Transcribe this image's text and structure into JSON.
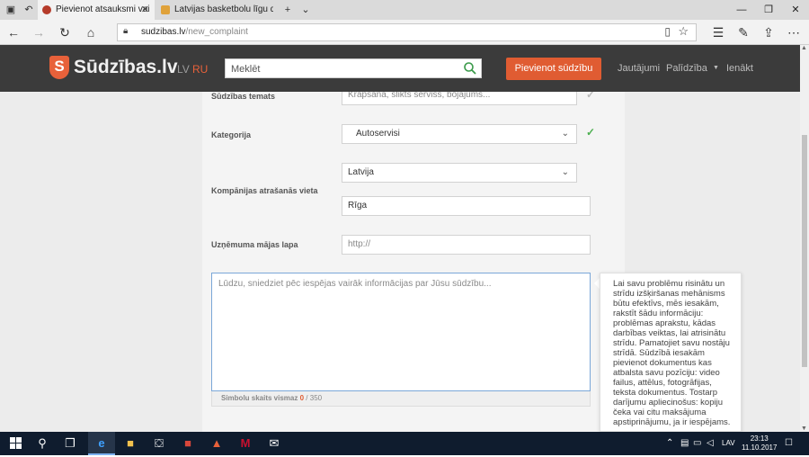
{
  "browser": {
    "tabs": [
      {
        "title": "Pievienot atsauksmi vai",
        "active": true
      },
      {
        "title": "Latvijas basketbolu līgu dire",
        "active": false
      }
    ],
    "url_domain": "sudzibas.lv",
    "url_path": "/new_complaint"
  },
  "header": {
    "logo_letter": "S",
    "logo_text": "Sūdzības.lv",
    "lang_lv": "LV",
    "lang_ru": "RU",
    "search_placeholder": "Meklēt",
    "add_button": "Pievienot sūdzību",
    "nav": {
      "faq": "Jautājumi",
      "help": "Palīdzība",
      "login": "Ienākt"
    },
    "accent_color": "#e05c32"
  },
  "form": {
    "topic_label": "Sūdzības temats",
    "topic_placeholder": "Krāpšana, slikts serviss, bojājums...",
    "category_label": "Kategorija",
    "category_value": "Autoservisi",
    "location_label": "Kompānijas atrašanās vieta",
    "country_value": "Latvija",
    "city_value": "Rīga",
    "website_label": "Uzņēmuma mājas lapa",
    "website_placeholder": "http://",
    "description_placeholder": "Lūdzu, sniedziet pēc iespējas vairāk informācijas par Jūsu sūdzību...",
    "counter_label": "Simbolu skaits vismaz",
    "counter_current": "0",
    "counter_required": "/ 350",
    "tooltip_text": "Lai savu problēmu risinātu un strīdu izšķiršanas mehānisms būtu efektīvs, mēs iesakām, rakstīt šādu informāciju: problēmas aprakstu, kādas darbības veiktas, lai atrisinātu strīdu. Pamatojiet savu nostāju strīdā. Sūdzībā iesakām pievienot dokumentus kas atbalsta savu pozīciju: video failus, attēlus, fotogrāfijas, teksta dokumentus. Tostarp darījumu apliecinošus: kopiju čeka vai citu maksājuma apstiprinājumu, ja ir iespējams."
  },
  "taskbar": {
    "language": "LAV",
    "time": "23:13",
    "date": "11.10.2017"
  }
}
